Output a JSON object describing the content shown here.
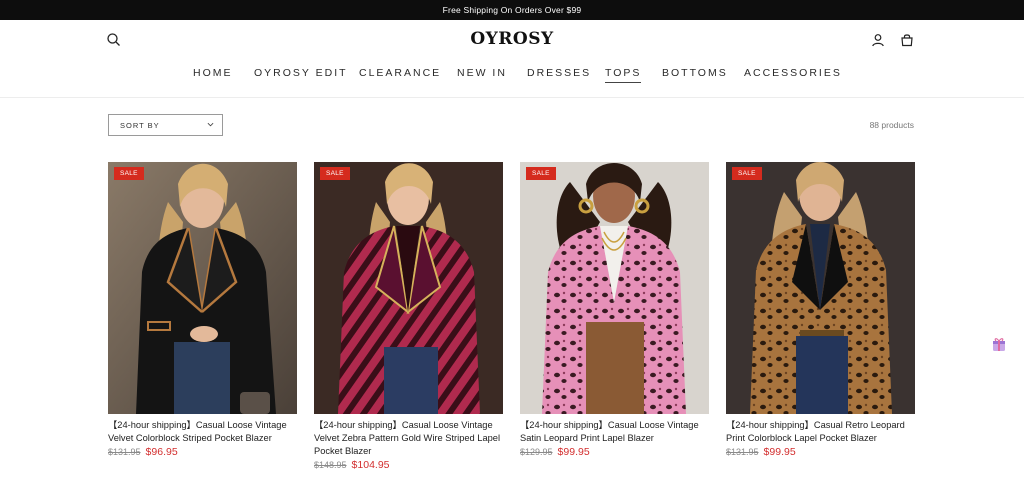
{
  "announcement": "Free Shipping On Orders Over $99",
  "header": {
    "logo": "OYROSY",
    "icons": [
      "search-icon",
      "account-icon",
      "bag-icon"
    ]
  },
  "nav": {
    "items": [
      {
        "label": "HOME"
      },
      {
        "label": "OYROSY EDIT"
      },
      {
        "label": "CLEARANCE"
      },
      {
        "label": "NEW IN"
      },
      {
        "label": "DRESSES"
      },
      {
        "label": "TOPS",
        "active": true
      },
      {
        "label": "BOTTOMS"
      },
      {
        "label": "ACCESSORIES"
      }
    ]
  },
  "toolbar": {
    "sort_label": "SORT BY",
    "product_count": "88 products"
  },
  "products": [
    {
      "badge": "SALE",
      "title": "【24-hour shipping】Casual Loose Vintage Velvet Colorblock Striped Pocket Blazer",
      "old_price": "$131.95",
      "price": "$96.95"
    },
    {
      "badge": "SALE",
      "title": "【24-hour shipping】Casual Loose Vintage Velvet Zebra Pattern Gold Wire Striped Lapel Pocket Blazer",
      "old_price": "$148.95",
      "price": "$104.95"
    },
    {
      "badge": "SALE",
      "title": "【24-hour shipping】Casual Loose Vintage Satin Leopard Print Lapel Blazer",
      "old_price": "$129.95",
      "price": "$99.95"
    },
    {
      "badge": "SALE",
      "title": "【24-hour shipping】Casual Retro Leopard Print Colorblock Lapel Pocket Blazer",
      "old_price": "$131.95",
      "price": "$99.95"
    }
  ],
  "colors": {
    "sale_badge": "#d52b1e",
    "sale_price": "#d32f2f",
    "announcement_bg": "#0d0d0d"
  }
}
